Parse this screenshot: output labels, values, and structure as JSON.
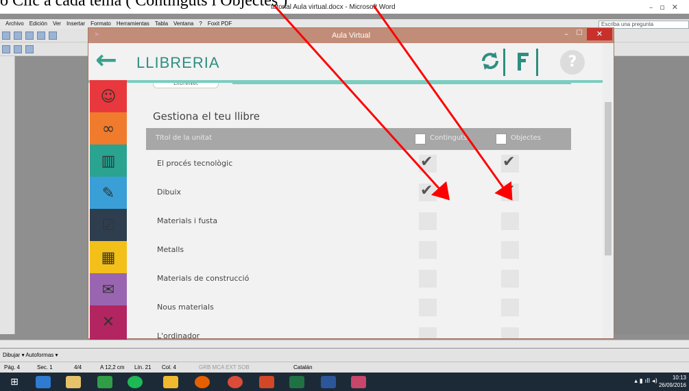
{
  "doc": {
    "heading": "o Clic a cada tema ( Continguts i Objectes )"
  },
  "word": {
    "title": "tutorial Aula virtual.docx - Microsoft Word",
    "menu": [
      "Archivo",
      "Edición",
      "Ver",
      "Insertar",
      "Formato",
      "Herramientas",
      "Tabla",
      "Ventana",
      "?",
      "Foxit PDF"
    ],
    "help_placeholder": "Escriba una pregunta",
    "drawing_bar": "Dibujar ▾  Autoformas ▾",
    "status": {
      "page": "Pág. 4",
      "section": "Sec. 1",
      "pages": "4/4",
      "position": "A 12,2 cm",
      "line": "Lín. 21",
      "col": "Col. 4",
      "flags": "GRB  MCA  EXT  SOB",
      "language": "Catalán"
    }
  },
  "taskbar": {
    "time": "10:13",
    "date": "26/09/2016"
  },
  "aula": {
    "window_title": "Aula Virtual",
    "app_title": "LLIBRERIA",
    "help_label": "?",
    "llibrenet": "LlibreNet",
    "section_title": "Gestiona el teu llibre",
    "table": {
      "col_title": "Títol de la unitat",
      "col_continguts": "Continguts",
      "col_objectes": "Objectes",
      "rows": [
        {
          "title": "El procés tecnològic",
          "continguts": true,
          "objectes": true
        },
        {
          "title": "Dibuix",
          "continguts": true,
          "objectes": true
        },
        {
          "title": "Materials i fusta",
          "continguts": false,
          "objectes": false
        },
        {
          "title": "Metalls",
          "continguts": false,
          "objectes": false
        },
        {
          "title": "Materials de construcció",
          "continguts": false,
          "objectes": false
        },
        {
          "title": "Nous materials",
          "continguts": false,
          "objectes": false
        },
        {
          "title": "L'ordinador",
          "continguts": false,
          "objectes": false
        }
      ]
    },
    "side_menu": [
      {
        "name": "smiley-icon",
        "color": "#e8383d",
        "glyph": "☺"
      },
      {
        "name": "glasses-icon",
        "color": "#f07b2c",
        "glyph": "∞"
      },
      {
        "name": "library-icon",
        "color": "#2aa391",
        "glyph": "▥"
      },
      {
        "name": "pencil-icon",
        "color": "#3a9fd6",
        "glyph": "✎"
      },
      {
        "name": "clipboard-icon",
        "color": "#2f3e4f",
        "glyph": "☑"
      },
      {
        "name": "calendar-icon",
        "color": "#f2c018",
        "glyph": "▦"
      },
      {
        "name": "envelope-icon",
        "color": "#9a65b0",
        "glyph": "✉"
      },
      {
        "name": "tools-icon",
        "color": "#b32560",
        "glyph": "✕"
      }
    ]
  },
  "colors": {
    "accent": "#2c8f80",
    "annotation_arrow": "#ff0000",
    "window_frame": "#c28d78"
  }
}
